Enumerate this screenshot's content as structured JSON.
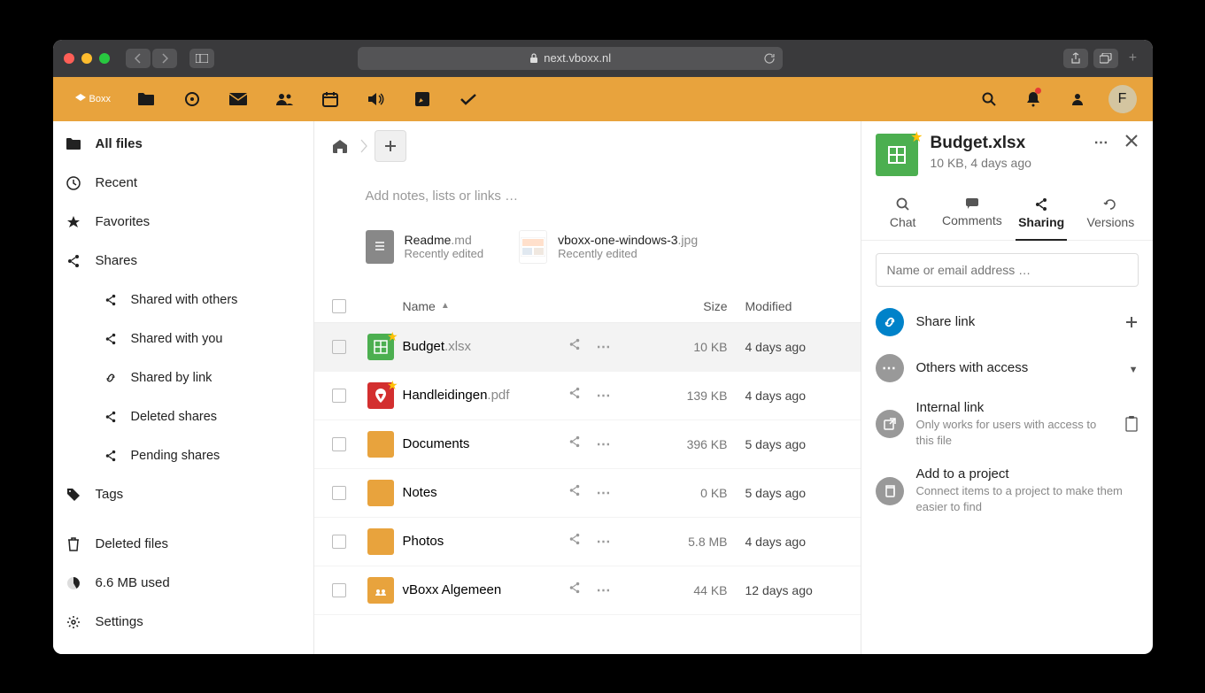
{
  "browser": {
    "url": "next.vboxx.nl"
  },
  "brand": "Boxx",
  "avatar_letter": "F",
  "sidebar": {
    "items": [
      {
        "label": "All files"
      },
      {
        "label": "Recent"
      },
      {
        "label": "Favorites"
      },
      {
        "label": "Shares"
      },
      {
        "label": "Shared with others"
      },
      {
        "label": "Shared with you"
      },
      {
        "label": "Shared by link"
      },
      {
        "label": "Deleted shares"
      },
      {
        "label": "Pending shares"
      },
      {
        "label": "Tags"
      },
      {
        "label": "Deleted files"
      },
      {
        "label": "6.6 MB used"
      },
      {
        "label": "Settings"
      }
    ]
  },
  "notes_placeholder": "Add notes, lists or links …",
  "recent": [
    {
      "name": "Readme",
      "ext": ".md",
      "sub": "Recently edited"
    },
    {
      "name": "vboxx-one-windows-3",
      "ext": ".jpg",
      "sub": "Recently edited"
    }
  ],
  "columns": {
    "name": "Name",
    "size": "Size",
    "modified": "Modified"
  },
  "files": [
    {
      "name": "Budget",
      "ext": ".xlsx",
      "size": "10 KB",
      "modified": "4 days ago",
      "type": "xlsx",
      "starred": true
    },
    {
      "name": "Handleidingen",
      "ext": ".pdf",
      "size": "139 KB",
      "modified": "4 days ago",
      "type": "pdf",
      "starred": true
    },
    {
      "name": "Documents",
      "ext": "",
      "size": "396 KB",
      "modified": "5 days ago",
      "type": "folder"
    },
    {
      "name": "Notes",
      "ext": "",
      "size": "0 KB",
      "modified": "5 days ago",
      "type": "folder"
    },
    {
      "name": "Photos",
      "ext": "",
      "size": "5.8 MB",
      "modified": "4 days ago",
      "type": "folder"
    },
    {
      "name": "vBoxx Algemeen",
      "ext": "",
      "size": "44 KB",
      "modified": "12 days ago",
      "type": "shared"
    }
  ],
  "details": {
    "title": "Budget.xlsx",
    "sub": "10 KB, 4 days ago",
    "tabs": [
      "Chat",
      "Comments",
      "Sharing",
      "Versions"
    ],
    "share_placeholder": "Name or email address …",
    "share_items": [
      {
        "title": "Share link",
        "sub": "",
        "icon": "link",
        "color": "blue",
        "action": "plus"
      },
      {
        "title": "Others with access",
        "sub": "",
        "icon": "dots",
        "color": "gray",
        "action": "caret"
      },
      {
        "title": "Internal link",
        "sub": "Only works for users with access to this file",
        "icon": "external",
        "color": "gray",
        "action": "clipboard"
      },
      {
        "title": "Add to a project",
        "sub": "Connect items to a project to make them easier to find",
        "icon": "copy",
        "color": "gray",
        "action": ""
      }
    ]
  }
}
